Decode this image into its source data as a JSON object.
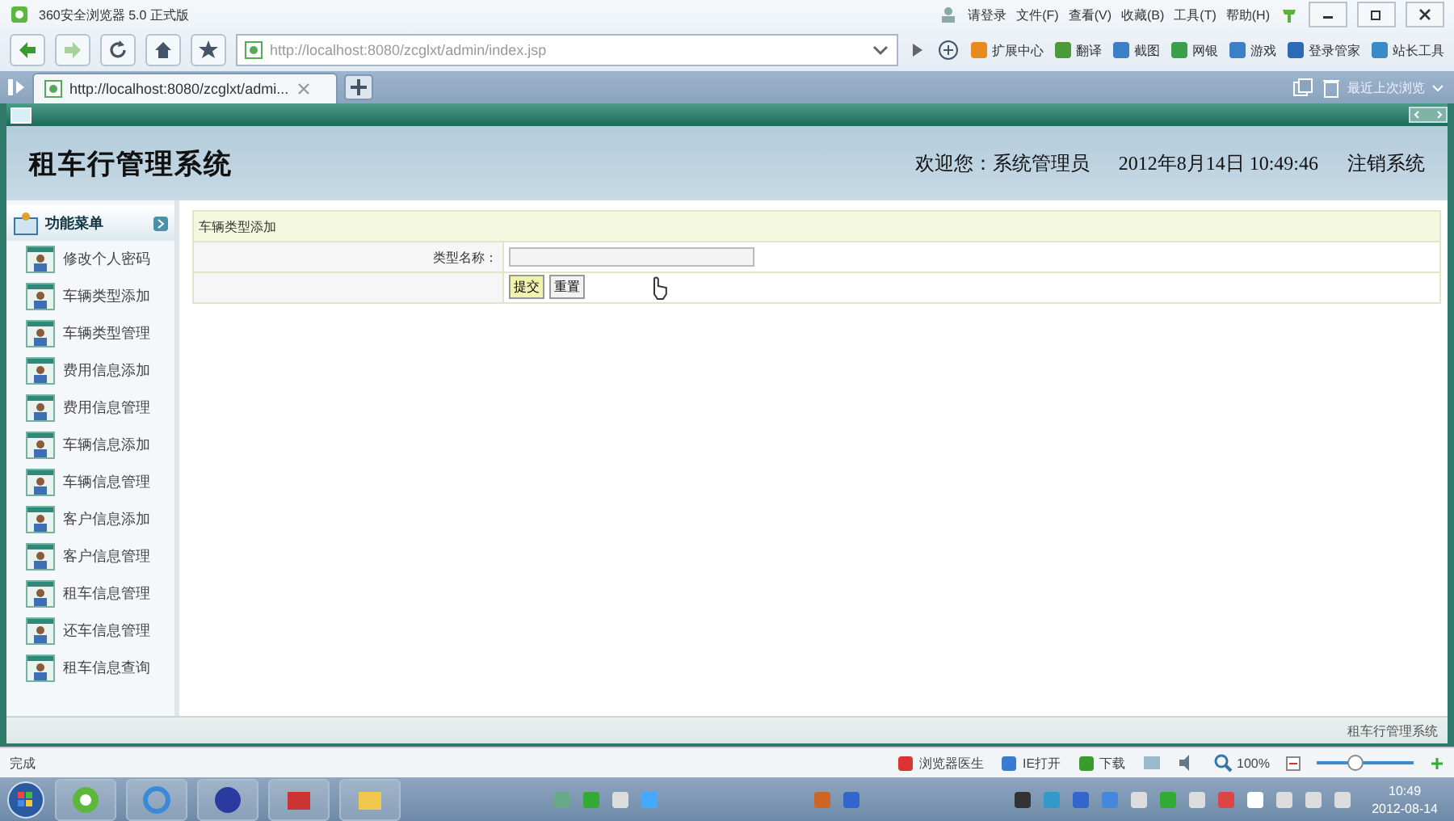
{
  "browser": {
    "title": "360安全浏览器 5.0 正式版",
    "menu": [
      "请登录",
      "文件(F)",
      "查看(V)",
      "收藏(B)",
      "工具(T)",
      "帮助(H)"
    ],
    "address": "http://localhost:8080/zcglxt/admin/index.jsp",
    "toolbar": [
      "扩展中心",
      "翻译",
      "截图",
      "网银",
      "游戏",
      "登录管家",
      "站长工具"
    ],
    "tabs": [
      {
        "label": "http://localhost:8080/zcglxt/admi...",
        "selected": true
      }
    ],
    "restore": "最近上次浏览"
  },
  "app": {
    "title": "租车行管理系统",
    "welcome": "欢迎您：系统管理员",
    "datetime": "2012年8月14日  10:49:46",
    "logout": "注销系统",
    "menu_title": "功能菜单",
    "menu": [
      "修改个人密码",
      "车辆类型添加",
      "车辆类型管理",
      "费用信息添加",
      "费用信息管理",
      "车辆信息添加",
      "车辆信息管理",
      "客户信息添加",
      "客户信息管理",
      "租车信息管理",
      "还车信息管理",
      "租车信息查询"
    ],
    "form": {
      "title": "车辆类型添加",
      "field_label": "类型名称：",
      "buttons": [
        "提交",
        "重置"
      ]
    },
    "footer": "租车行管理系统"
  },
  "status": {
    "text": "完成",
    "items": [
      "浏览器医生",
      "IE打开",
      "下载"
    ],
    "zoom": "100%",
    "level": 0.4
  },
  "taskbar": {
    "time": "10:49",
    "date": "2012-08-14"
  }
}
